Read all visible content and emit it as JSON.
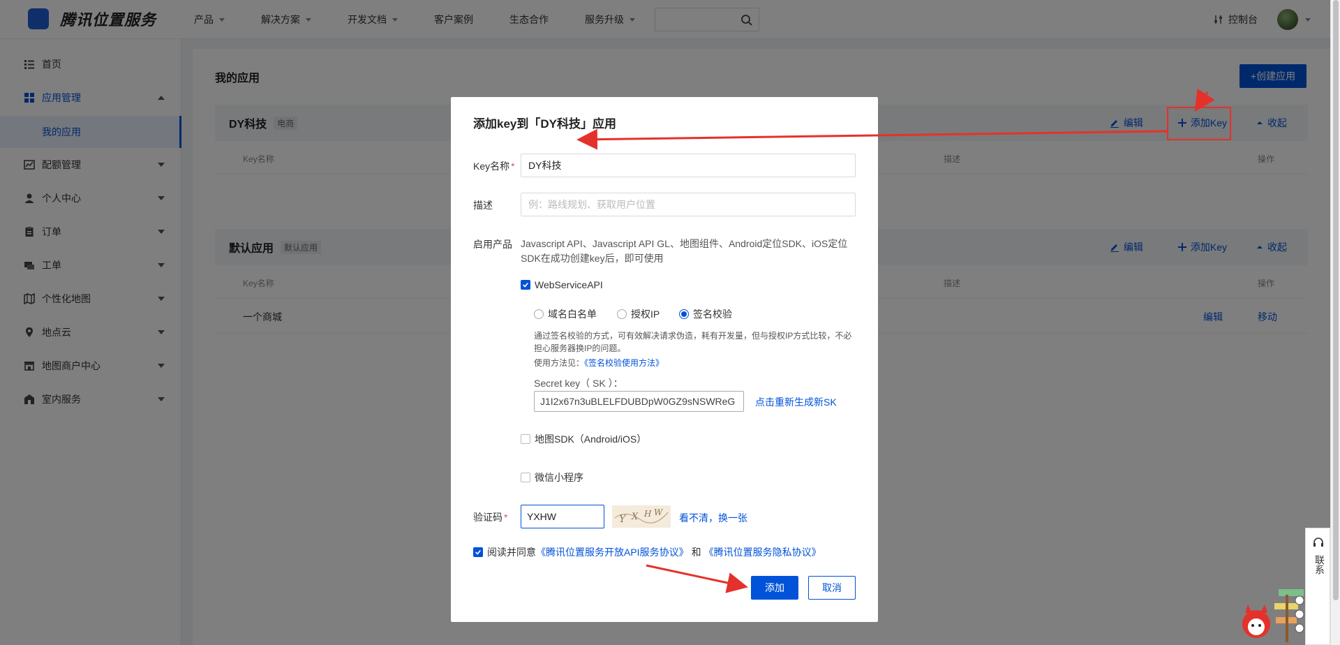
{
  "brand": {
    "name": "腾讯位置服务"
  },
  "nav": {
    "items": [
      {
        "label": "产品",
        "has_dropdown": true
      },
      {
        "label": "解决方案",
        "has_dropdown": true
      },
      {
        "label": "开发文档",
        "has_dropdown": true
      },
      {
        "label": "客户案例",
        "has_dropdown": false
      },
      {
        "label": "生态合作",
        "has_dropdown": false
      },
      {
        "label": "服务升级",
        "has_dropdown": true
      }
    ],
    "search_placeholder": "",
    "console_label": "控制台"
  },
  "sidebar": {
    "items": [
      {
        "label": "首页",
        "icon": "list-icon"
      },
      {
        "label": "应用管理",
        "icon": "grid-icon",
        "expanded": true
      },
      {
        "label": "配额管理",
        "icon": "chart-icon"
      },
      {
        "label": "个人中心",
        "icon": "user-icon"
      },
      {
        "label": "订单",
        "icon": "clipboard-icon"
      },
      {
        "label": "工单",
        "icon": "ticket-icon"
      },
      {
        "label": "个性化地图",
        "icon": "map-icon"
      },
      {
        "label": "地点云",
        "icon": "pin-icon"
      },
      {
        "label": "地图商户中心",
        "icon": "store-icon"
      },
      {
        "label": "室内服务",
        "icon": "building-icon"
      }
    ],
    "sub_item": "我的应用"
  },
  "main": {
    "title": "我的应用",
    "create_button": "+创建应用",
    "apps": [
      {
        "name": "DY科技",
        "tag": "电商",
        "actions": {
          "edit": "编辑",
          "add_key": "添加Key",
          "collapse": "收起"
        },
        "columns": [
          "Key名称",
          "描述",
          "操作"
        ],
        "rows": []
      },
      {
        "name": "默认应用",
        "tag": "默认应用",
        "actions": {
          "edit": "编辑",
          "add_key": "添加Key",
          "collapse": "收起"
        },
        "columns": [
          "Key名称",
          "描述",
          "操作"
        ],
        "rows": [
          {
            "key_name": "一个商城",
            "edit": "编辑",
            "move": "移动"
          }
        ]
      }
    ]
  },
  "modal": {
    "title": "添加key到「DY科技」应用",
    "key_name_label": "Key名称",
    "key_name_value": "DY科技",
    "desc_label": "描述",
    "desc_placeholder": "例：路线规划、获取用户位置",
    "products_label": "启用产品",
    "products_text": "Javascript API、Javascript API GL、地图组件、Android定位SDK、iOS定位SDK在成功创建key后，即可使用",
    "webservice_label": "WebServiceAPI",
    "webservice_checked": true,
    "radios": [
      {
        "label": "域名白名单",
        "selected": false
      },
      {
        "label": "授权IP",
        "selected": false
      },
      {
        "label": "签名校验",
        "selected": true
      }
    ],
    "sign_desc": "通过签名校验的方式，可有效解决请求伪造，耗有开发量，但与授权IP方式比较，不必担心服务器换IP的问题。",
    "usage_prefix": "使用方法见：",
    "usage_link": "《签名校验使用方法》",
    "sk_label": "Secret key（ SK ）：",
    "sk_value": "J1I2x67n3uBLELFDUBDpW0GZ9sNSWReG",
    "sk_regen": "点击重新生成新SK",
    "sdk_label": "地图SDK（Android/iOS）",
    "sdk_checked": false,
    "miniprogram_label": "微信小程序",
    "miniprogram_checked": false,
    "captcha_label": "验证码",
    "captcha_value": "YXHW",
    "captcha_refresh": "看不清，换一张",
    "agree_prefix": "阅读并同意",
    "agree_link1": "《腾讯位置服务开放API服务协议》",
    "agree_and": "和",
    "agree_link2": "《腾讯位置服务隐私协议》",
    "agree_checked": true,
    "add_button": "添加",
    "cancel_button": "取消"
  },
  "contact": {
    "label": "联系"
  },
  "colors": {
    "primary": "#0052d9",
    "annotation_red": "#e5312b",
    "overlay": "rgba(0,0,0,0.5)"
  }
}
